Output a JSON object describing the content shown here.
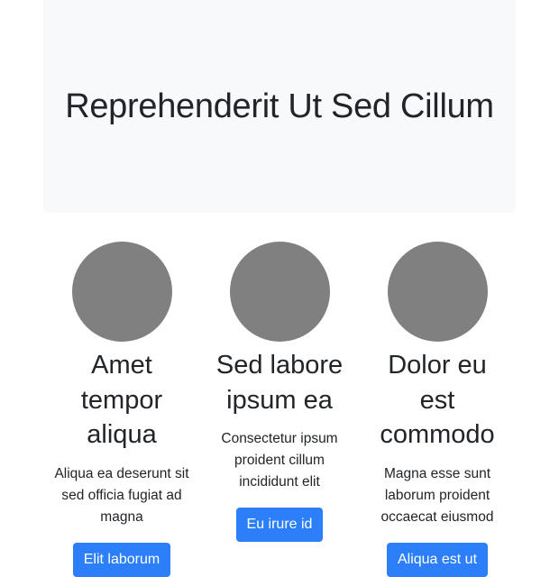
{
  "hero": {
    "title": "Reprehenderit Ut Sed Cillum"
  },
  "cards": [
    {
      "title": "Amet tempor aliqua",
      "text": "Aliqua ea deserunt sit sed officia fugiat ad magna",
      "button": "Elit laborum"
    },
    {
      "title": "Sed labore ipsum ea",
      "text": "Consectetur ipsum proident cillum incididunt elit",
      "button": "Eu irure id"
    },
    {
      "title": "Dolor eu est commodo",
      "text": "Magna esse sunt laborum proident occaecat eiusmod",
      "button": "Aliqua est ut"
    }
  ],
  "colors": {
    "hero_background": "#f8f9fa",
    "avatar_placeholder": "#808080",
    "button_primary": "#2d7ff9",
    "text": "#212529"
  }
}
